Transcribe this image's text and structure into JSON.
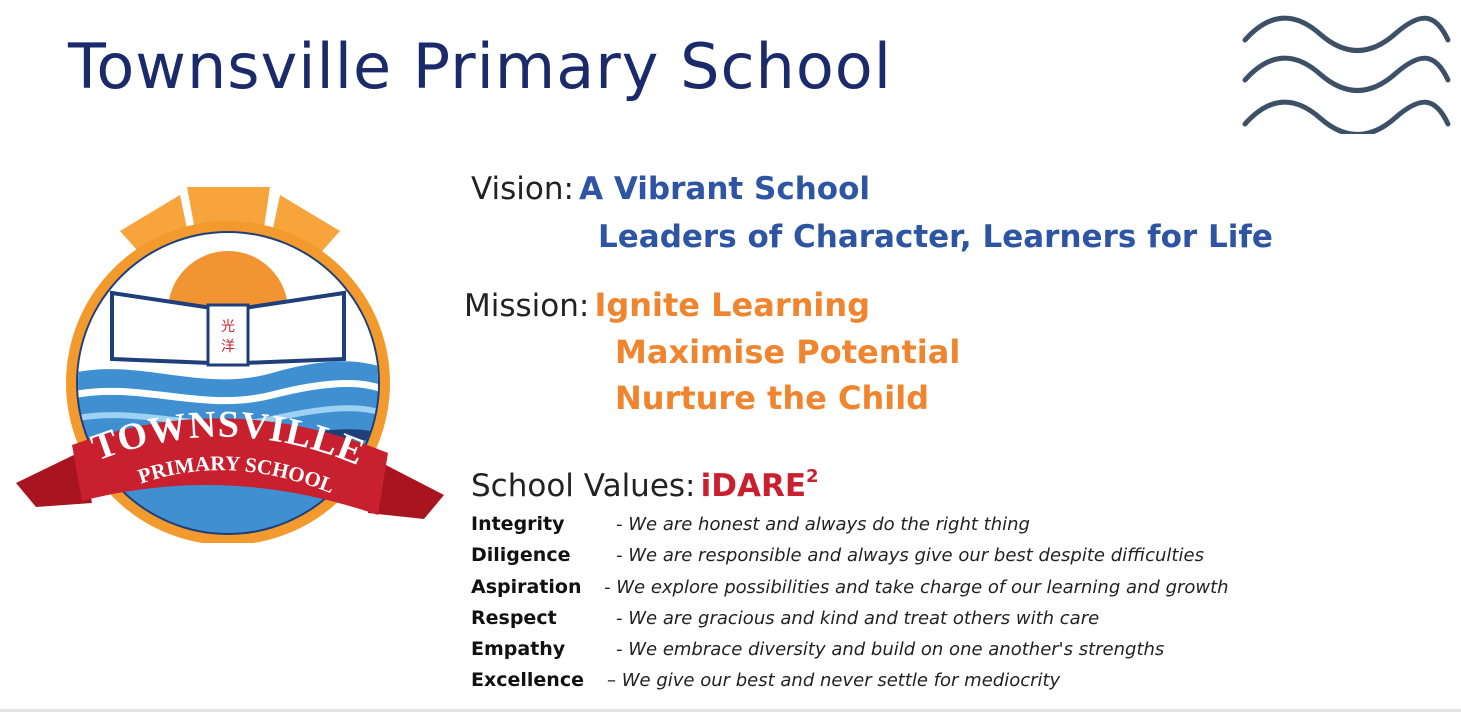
{
  "title": "Townsville Primary School",
  "vision": {
    "label": "Vision:",
    "line1": "A Vibrant School",
    "line2": "Leaders of Character, Learners for Life"
  },
  "mission": {
    "label": "Mission:",
    "items": [
      "Ignite Learning",
      "Maximise Potential",
      "Nurture the Child"
    ]
  },
  "values": {
    "label": "School Values:",
    "brand": "iDARE",
    "brand_sup": "2",
    "items": [
      {
        "name": "Integrity",
        "sep": "-",
        "desc": "We are honest and always do the right thing"
      },
      {
        "name": "Diligence",
        "sep": "-",
        "desc": "We are responsible and always give our best despite difficulties"
      },
      {
        "name": "Aspiration",
        "sep": "-",
        "desc": "We explore possibilities and take charge of our learning and growth"
      },
      {
        "name": "Respect",
        "sep": "-",
        "desc": "We are gracious and kind and treat others with care"
      },
      {
        "name": "Empathy",
        "sep": "-",
        "desc": "We embrace diversity and build on one another's strengths"
      },
      {
        "name": "Excellence",
        "sep": "–",
        "desc": "We give our best and never settle for mediocrity"
      }
    ]
  },
  "logo": {
    "banner_line1": "TOWNSVILLE",
    "banner_line2": "PRIMARY SCHOOL",
    "book_chars": [
      "光",
      "洋"
    ]
  },
  "colors": {
    "title": "#1b2a6b",
    "vision": "#2e55a3",
    "mission": "#f0852f",
    "idare": "#c91f2e",
    "waves": "#3d5066",
    "logo_ring": "#f39a2e",
    "logo_navy": "#1f3f7a",
    "logo_ribbon": "#c8202f"
  }
}
